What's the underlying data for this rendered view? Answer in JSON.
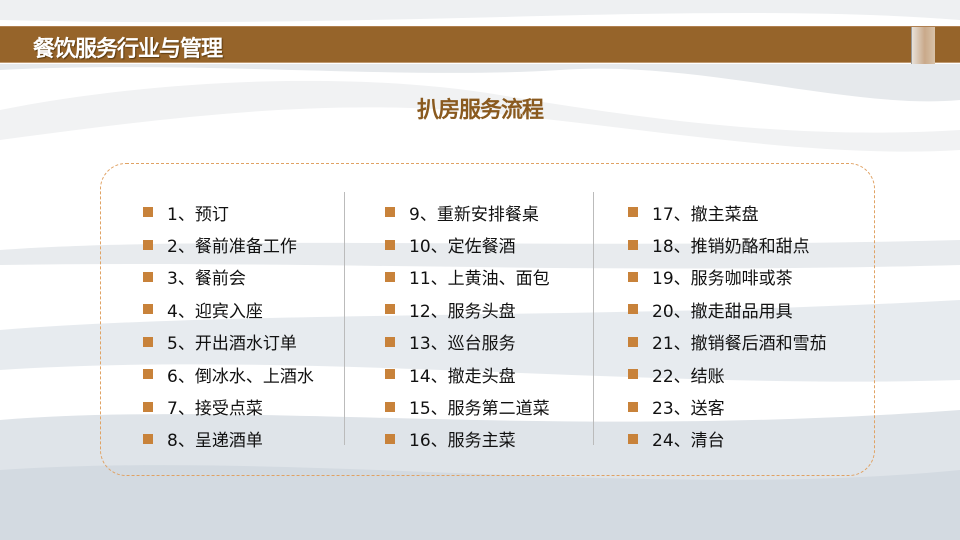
{
  "header": {
    "title": "餐饮服务行业与管理"
  },
  "page_title": "扒房服务流程",
  "colors": {
    "accent": "#96642a",
    "bullet": "#c8823a",
    "title": "#8a5a1f"
  },
  "columns": [
    [
      "1、预订",
      "2、餐前准备工作",
      "3、餐前会",
      "4、迎宾入座",
      "5、开出酒水订单",
      "6、倒冰水、上酒水",
      "7、接受点菜",
      "8、呈递酒单"
    ],
    [
      "9、重新安排餐桌",
      "10、定佐餐酒",
      "11、上黄油、面包",
      "12、服务头盘",
      "13、巡台服务",
      "14、撤走头盘",
      "15、服务第二道菜",
      "16、服务主菜"
    ],
    [
      "17、撤主菜盘",
      "18、推销奶酪和甜点",
      "19、服务咖啡或茶",
      "20、撤走甜品用具",
      "21、撤销餐后酒和雪茄",
      "22、结账",
      "23、送客",
      "24、清台"
    ]
  ]
}
